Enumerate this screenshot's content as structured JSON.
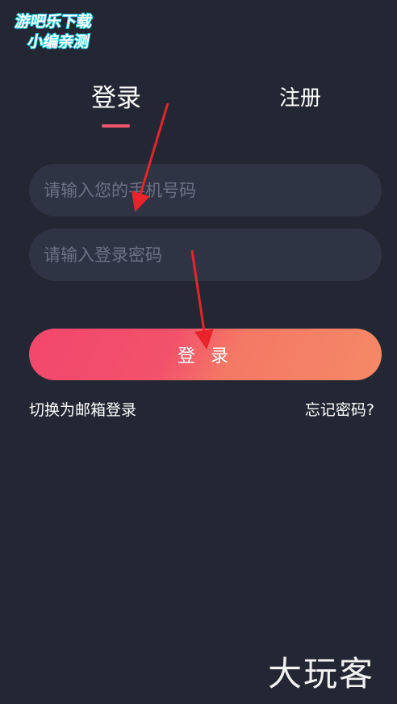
{
  "watermark_top": {
    "line1": "游吧乐下载",
    "line2": "小编亲测"
  },
  "tabs": {
    "login": "登录",
    "register": "注册"
  },
  "form": {
    "phone_placeholder": "请输入您的手机号码",
    "password_placeholder": "请输入登录密码",
    "submit_label": "登 录"
  },
  "links": {
    "switch_email": "切换为邮箱登录",
    "forgot_password": "忘记密码?"
  },
  "watermark_bottom": "大玩客",
  "colors": {
    "background": "#232733",
    "field_background": "#2f3445",
    "accent": "#f1546d",
    "button_gradient_start": "#f2476c",
    "button_gradient_end": "#f58966",
    "arrow": "#e8242a"
  }
}
